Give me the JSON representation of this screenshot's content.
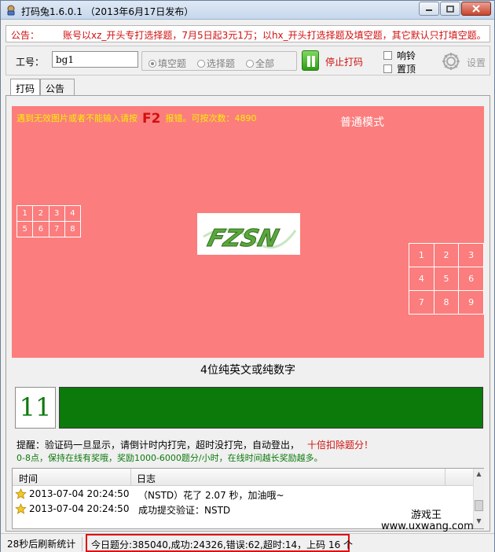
{
  "window": {
    "title": "打码兔1.6.0.1 （2013年6月17日发布）"
  },
  "notice": {
    "label": "公告：",
    "text": "账号以xz_开头专打选择题，7月5日起3元1万；以hx_开头打选择题及填空题，其它默认只打填空题。"
  },
  "toolbar": {
    "employee_label": "工号：",
    "employee_value": "bg1",
    "radios": [
      {
        "label": "填空题",
        "selected": true
      },
      {
        "label": "选择题",
        "selected": false
      },
      {
        "label": "全部",
        "selected": false
      }
    ],
    "stop_label": "停止打码",
    "checkbox_ring": "响铃",
    "checkbox_top": "置顶",
    "settings_label": "设置"
  },
  "tabs": [
    {
      "label": "打码",
      "active": true
    },
    {
      "label": "公告",
      "active": false
    }
  ],
  "work": {
    "hint_prefix": "遇到无效图片或者不能输入请按",
    "hint_key": "F2",
    "hint_suffix": "报错。可按次数：4890",
    "mode": "普通模式",
    "grid8": [
      "1",
      "2",
      "3",
      "4",
      "5",
      "6",
      "7",
      "8"
    ],
    "grid9": [
      "1",
      "2",
      "3",
      "4",
      "5",
      "6",
      "7",
      "8",
      "9"
    ],
    "captcha_text": "FZSN",
    "caption": "4位纯英文或纯数字",
    "countdown": "11",
    "progress_fraction": 1.0
  },
  "reminders": {
    "line1": "提醒：验证码一旦显示，请倒计时内打完，超时没打完，自动登出，",
    "line1_red": "十倍扣除题分！",
    "line2": "0-8点，保持在线有奖哦，奖励1000-6000题分/小时，在线时间越长奖励越多。"
  },
  "log": {
    "columns": [
      "时间",
      "日志"
    ],
    "rows": [
      {
        "time": "2013-07-04 20:24:50",
        "message": "（NSTD）花了 2.07 秒，加油哦~"
      },
      {
        "time": "2013-07-04 20:24:50",
        "message": "成功提交验证：NSTD"
      }
    ]
  },
  "watermark": {
    "name": "游戏王",
    "url": "www.uxwang.com"
  },
  "status": {
    "refresh": "28秒后刷新统计",
    "stats": "今日题分:385040,成功:24326,错误:62,超时:14，上码 16 个"
  },
  "colors": {
    "notice_text": "#d01010",
    "canvas_bg": "#fb7d7d",
    "progress_fill": "#0b7a0b",
    "countdown_text": "#0c7a0c",
    "status_highlight": "#e01010"
  }
}
